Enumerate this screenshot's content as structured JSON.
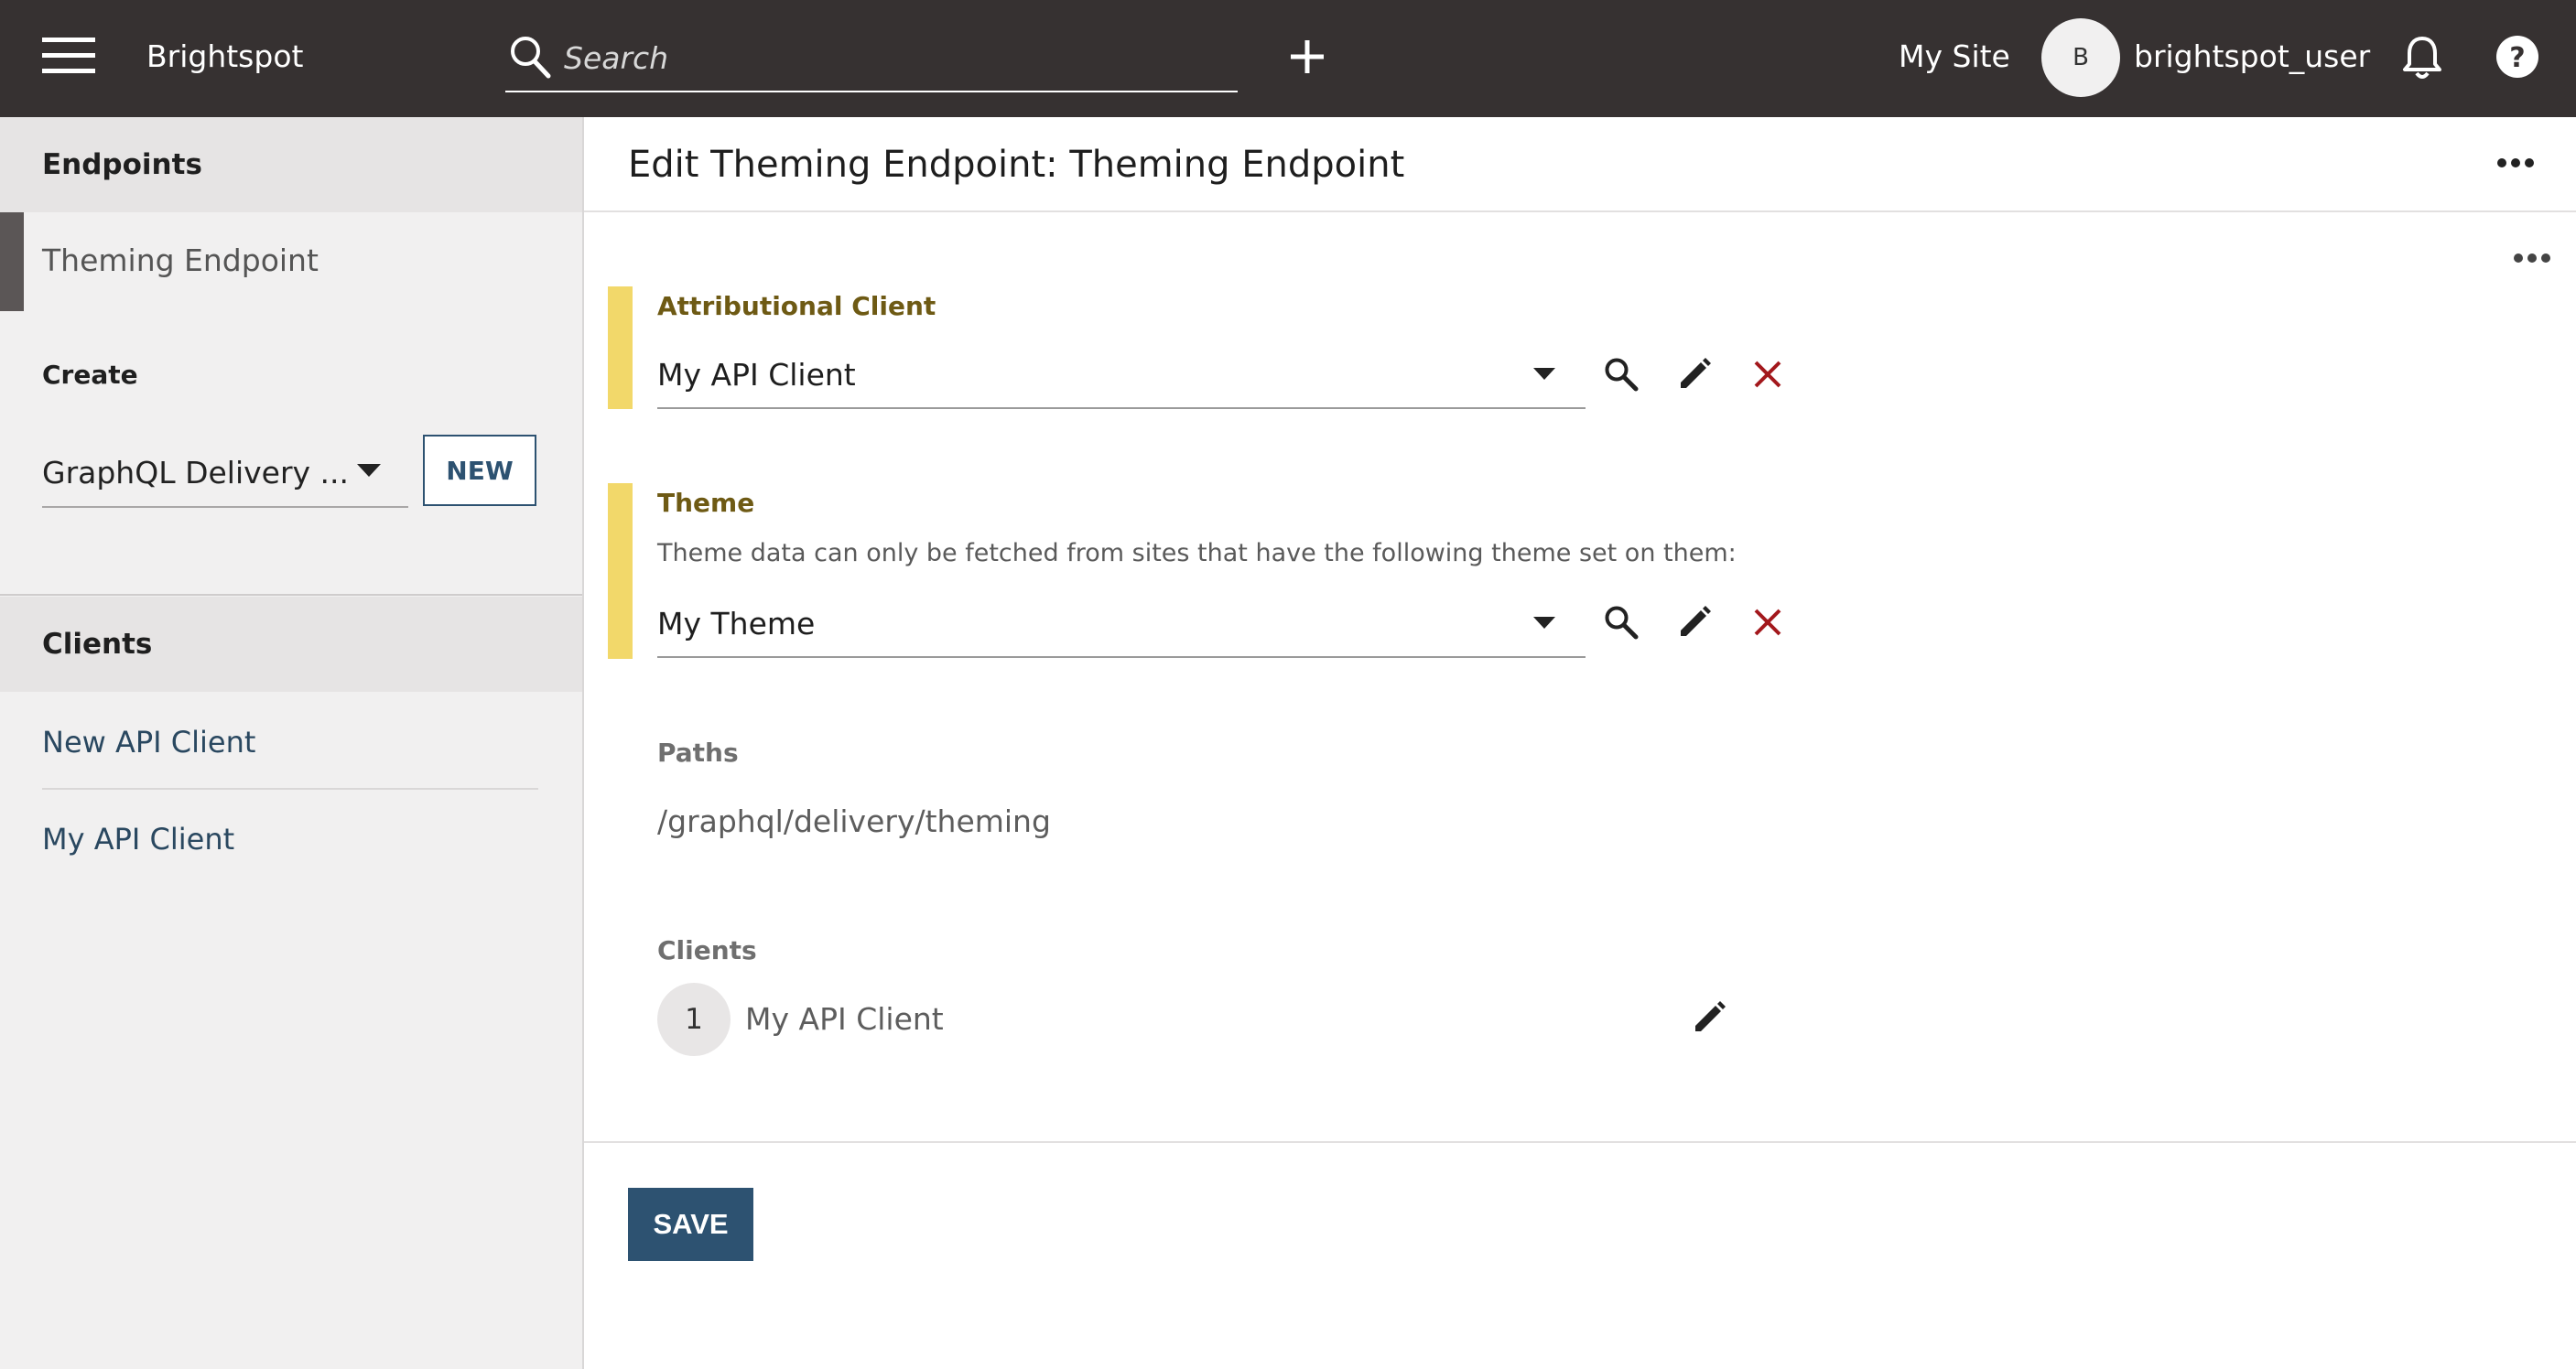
{
  "app": {
    "name": "Brightspot"
  },
  "header": {
    "search_placeholder": "Search",
    "site_label": "My Site",
    "avatar_initial": "B",
    "username": "brightspot_user"
  },
  "sidebar": {
    "endpoints_heading": "Endpoints",
    "endpoints": [
      {
        "label": "Theming Endpoint",
        "selected": true
      }
    ],
    "create_label": "Create",
    "create_select_value": "GraphQL Delivery ...",
    "new_button": "NEW",
    "clients_heading": "Clients",
    "clients": [
      {
        "label": "New API Client"
      },
      {
        "label": "My API Client"
      }
    ]
  },
  "main": {
    "title": "Edit Theming Endpoint: Theming Endpoint",
    "attributional_client": {
      "label": "Attributional Client",
      "value": "My API Client"
    },
    "theme": {
      "label": "Theme",
      "help": "Theme data can only be fetched from sites that have the following theme set on them:",
      "value": "My Theme"
    },
    "paths": {
      "label": "Paths",
      "value": "/graphql/delivery/theming"
    },
    "clients": {
      "label": "Clients",
      "items": [
        {
          "index": "1",
          "name": "My API Client"
        }
      ]
    },
    "save_button": "SAVE"
  },
  "colors": {
    "topbar": "#363131",
    "accent": "#2d5271",
    "field_marker": "#f2d86a",
    "remove": "#a3181c"
  },
  "icons": [
    "menu-icon",
    "search-icon",
    "plus-icon",
    "bell-icon",
    "help-icon",
    "more-icon",
    "dropdown-arrow-icon",
    "edit-icon",
    "close-icon"
  ]
}
